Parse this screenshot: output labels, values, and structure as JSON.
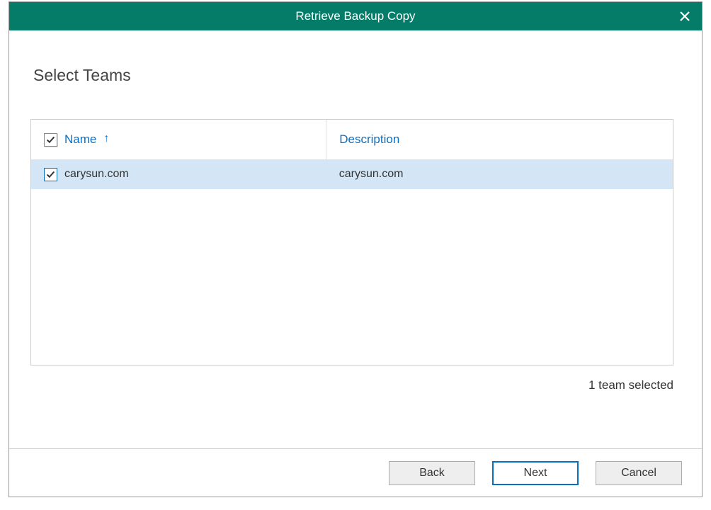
{
  "dialog": {
    "title": "Retrieve Backup Copy"
  },
  "page": {
    "heading": "Select Teams"
  },
  "table": {
    "columns": {
      "name": "Name",
      "description": "Description"
    },
    "rows": [
      {
        "checked": true,
        "name": "carysun.com",
        "description": "carysun.com"
      }
    ]
  },
  "status": {
    "selected_text": "1 team selected"
  },
  "buttons": {
    "back": "Back",
    "next": "Next",
    "cancel": "Cancel"
  }
}
